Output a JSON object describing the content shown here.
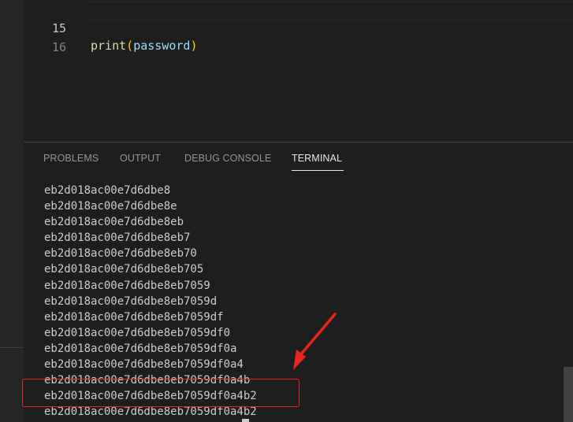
{
  "editor": {
    "lines": [
      {
        "number": "15",
        "fn": "print",
        "open": "(",
        "arg": "password",
        "close": ")"
      },
      {
        "number": "16",
        "fn": "",
        "open": "",
        "arg": "",
        "close": ""
      }
    ]
  },
  "panel": {
    "tabs": [
      {
        "label": "PROBLEMS",
        "active": false
      },
      {
        "label": "OUTPUT",
        "active": false
      },
      {
        "label": "DEBUG CONSOLE",
        "active": false
      },
      {
        "label": "TERMINAL",
        "active": true
      }
    ],
    "terminal_lines": [
      "eb2d018ac00e7d6dbe8",
      "eb2d018ac00e7d6dbe8e",
      "eb2d018ac00e7d6dbe8eb",
      "eb2d018ac00e7d6dbe8eb7",
      "eb2d018ac00e7d6dbe8eb70",
      "eb2d018ac00e7d6dbe8eb705",
      "eb2d018ac00e7d6dbe8eb7059",
      "eb2d018ac00e7d6dbe8eb7059d",
      "eb2d018ac00e7d6dbe8eb7059df",
      "eb2d018ac00e7d6dbe8eb7059df0",
      "eb2d018ac00e7d6dbe8eb7059df0a",
      "eb2d018ac00e7d6dbe8eb7059df0a4",
      "eb2d018ac00e7d6dbe8eb7059df0a4b",
      "eb2d018ac00e7d6dbe8eb7059df0a4b2",
      "eb2d018ac00e7d6dbe8eb7059df0a4b2"
    ]
  },
  "annotation": {
    "color": "#e8251f"
  }
}
